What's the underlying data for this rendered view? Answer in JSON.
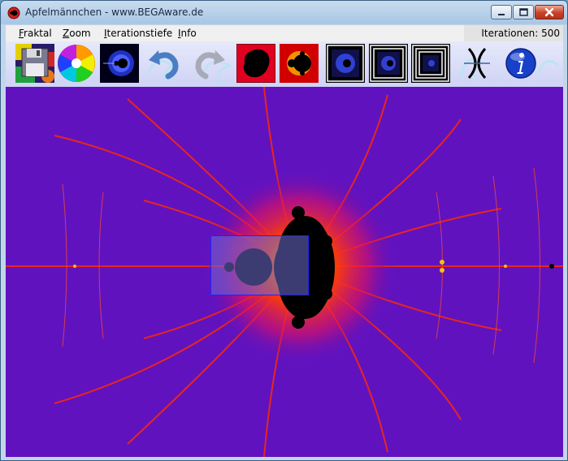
{
  "window": {
    "title": "Apfelmännchen - www.BEGAware.de",
    "controls": {
      "minimize": "minimize",
      "maximize": "maximize",
      "close": "close"
    }
  },
  "menu": [
    {
      "accel": "F",
      "rest": "raktal"
    },
    {
      "accel": "Z",
      "rest": "oom"
    },
    {
      "accel": "I",
      "rest": "terationstiefe"
    },
    {
      "accel": "I",
      "rest": "nfo"
    }
  ],
  "status": {
    "iterations_text": "Iterationen: 500"
  },
  "toolbar": {
    "buttons": [
      {
        "name": "save-icon"
      },
      {
        "name": "color-wheel-icon"
      },
      {
        "name": "mandelbrot-preview-icon"
      },
      {
        "name": "undo-icon"
      },
      {
        "name": "redo-icon"
      },
      {
        "name": "julia-dark-icon"
      },
      {
        "name": "mandelbrot-red-icon"
      },
      {
        "name": "zoom-frame-1-icon"
      },
      {
        "name": "zoom-frame-2-icon"
      },
      {
        "name": "zoom-frame-3-icon"
      },
      {
        "name": "fractal-symbol-icon"
      },
      {
        "name": "info-icon"
      }
    ]
  },
  "colors": {
    "fractal_background": "#5a0fbf",
    "fractal_edge": "#ff2a00",
    "fractal_glow": "#ffd400",
    "set_color": "#000000",
    "selection": "#2020ff"
  }
}
